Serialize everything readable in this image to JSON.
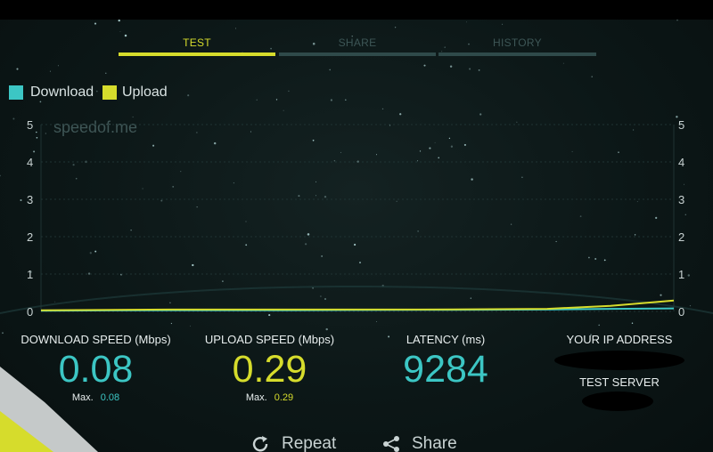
{
  "tabs": [
    {
      "label": "TEST",
      "active": true
    },
    {
      "label": "SHARE",
      "active": false
    },
    {
      "label": "HISTORY",
      "active": false
    }
  ],
  "legend": {
    "download_label": "Download",
    "upload_label": "Upload",
    "download_color": "#3cc6c4",
    "upload_color": "#d6dc2c"
  },
  "watermark": "speedof.me",
  "chart_data": {
    "type": "line",
    "title": "",
    "xlabel": "",
    "ylabel": "",
    "ylim": [
      0,
      5
    ],
    "y_ticks": [
      "0",
      "1",
      "2",
      "3",
      "4",
      "5"
    ],
    "x": [
      0,
      0.2,
      0.4,
      0.6,
      0.8,
      0.9,
      1.0
    ],
    "series": [
      {
        "name": "Download",
        "color": "#3cc6c4",
        "values": [
          0.02,
          0.03,
          0.03,
          0.04,
          0.05,
          0.07,
          0.08
        ]
      },
      {
        "name": "Upload",
        "color": "#d6dc2c",
        "values": [
          0.03,
          0.05,
          0.05,
          0.05,
          0.07,
          0.15,
          0.29
        ]
      }
    ],
    "grid": true
  },
  "stats": {
    "download": {
      "label": "DOWNLOAD SPEED (Mbps)",
      "value": "0.08",
      "max_label": "Max.",
      "max_value": "0.08"
    },
    "upload": {
      "label": "UPLOAD SPEED (Mbps)",
      "value": "0.29",
      "max_label": "Max.",
      "max_value": "0.29"
    },
    "latency": {
      "label": "LATENCY (ms)",
      "value": "9284"
    },
    "ip": {
      "label": "YOUR IP ADDRESS"
    },
    "server": {
      "label": "TEST SERVER"
    }
  },
  "actions": {
    "repeat_label": "Repeat",
    "share_label": "Share"
  }
}
